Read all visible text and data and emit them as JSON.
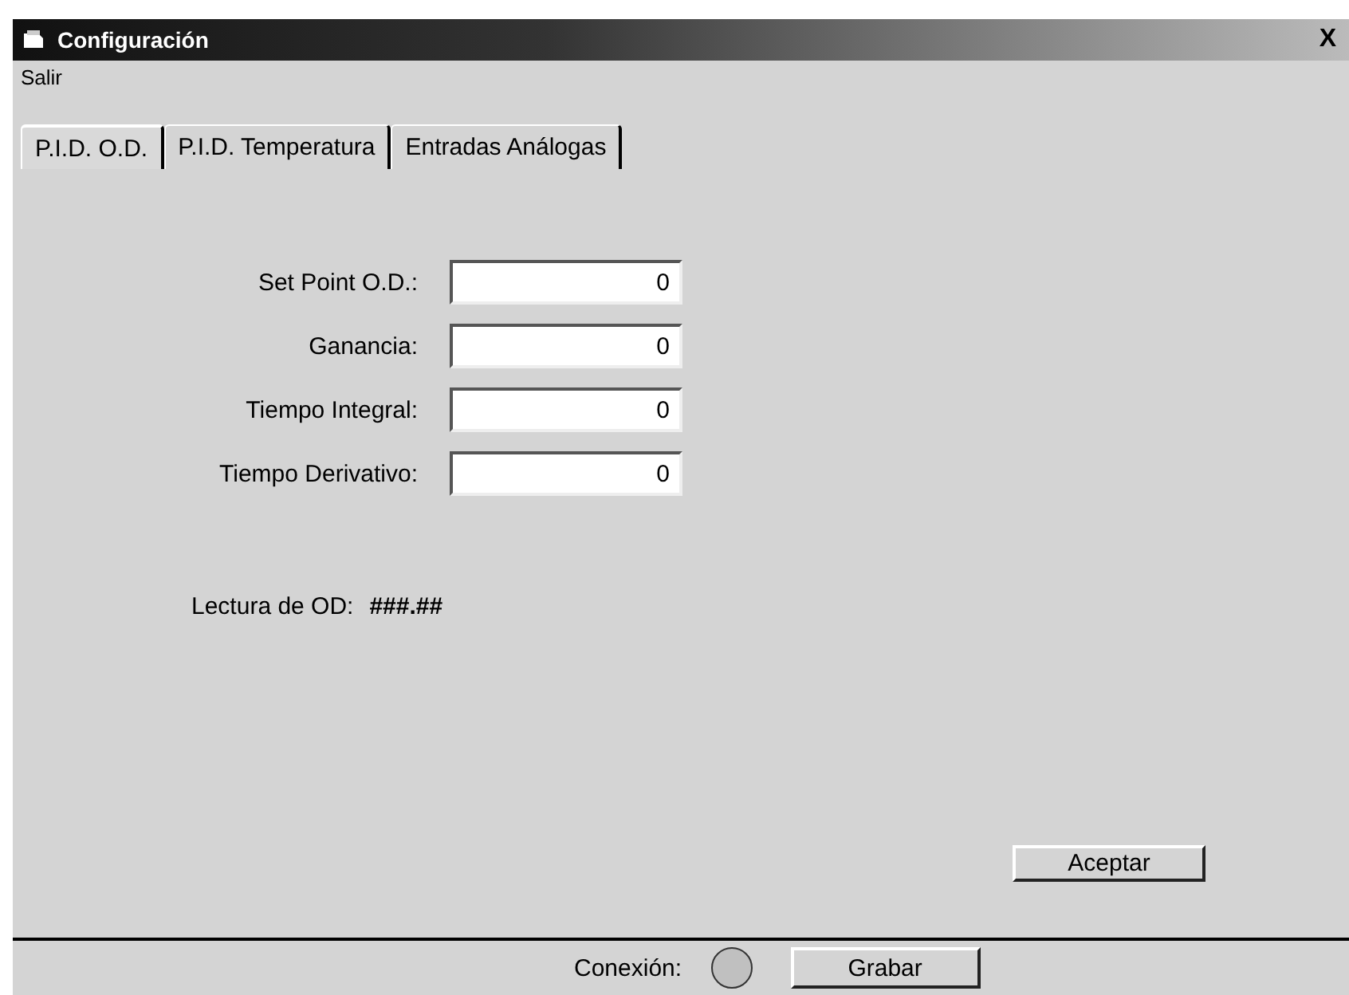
{
  "window": {
    "title": "Configuración",
    "close": "X"
  },
  "menu": [
    "Salir"
  ],
  "tabs": [
    {
      "label": "P.I.D. O.D.",
      "selected": true
    },
    {
      "label": "P.I.D. Temperatura",
      "selected": false
    },
    {
      "label": "Entradas Análogas",
      "selected": false
    }
  ],
  "fields": [
    {
      "label": "Set Point O.D.:",
      "value": "0"
    },
    {
      "label": "Ganancia:",
      "value": "0"
    },
    {
      "label": "Tiempo Integral:",
      "value": "0"
    },
    {
      "label": "Tiempo Derivativo:",
      "value": "0"
    }
  ],
  "reading": {
    "label": "Lectura de OD:",
    "value": "###.##"
  },
  "accept_button": "Aceptar",
  "status": {
    "label": "Conexión:",
    "indicator": {
      "color": "#c0c0c0"
    },
    "button": "Grabar"
  }
}
